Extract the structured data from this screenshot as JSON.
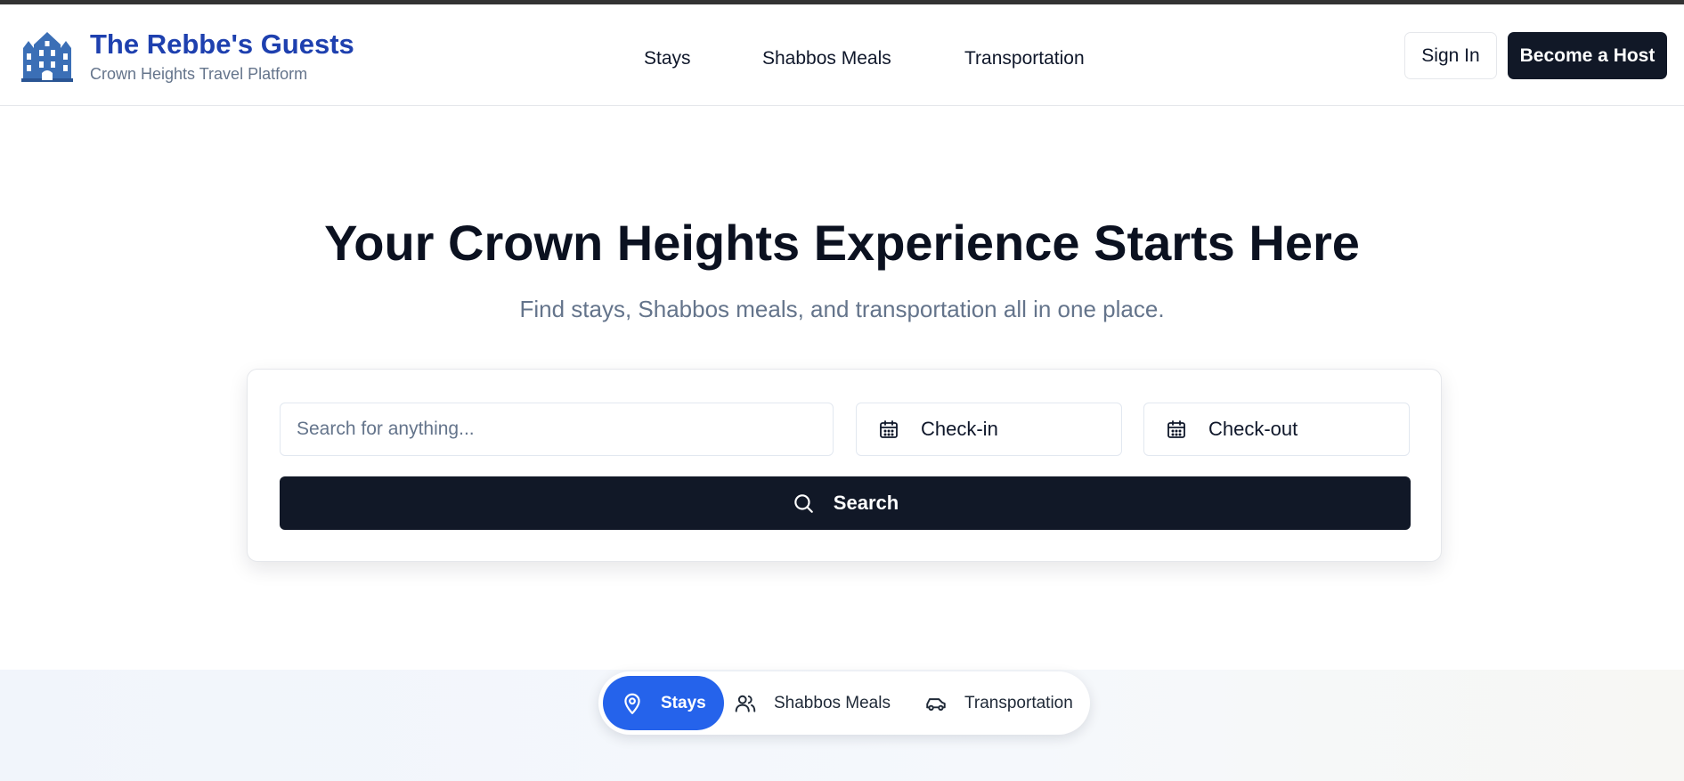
{
  "brand": {
    "title": "The Rebbe's Guests",
    "subtitle": "Crown Heights Travel Platform",
    "icon": "building-icon"
  },
  "nav": {
    "items": [
      {
        "label": "Stays"
      },
      {
        "label": "Shabbos Meals"
      },
      {
        "label": "Transportation"
      }
    ]
  },
  "auth": {
    "sign_in_label": "Sign In",
    "become_host_label": "Become a Host"
  },
  "hero": {
    "title": "Your Crown Heights Experience Starts Here",
    "subtitle": "Find stays, Shabbos meals, and transportation all in one place."
  },
  "search": {
    "placeholder": "Search for anything...",
    "value": "",
    "check_in_label": "Check-in",
    "check_out_label": "Check-out",
    "button_label": "Search",
    "icons": [
      "calendar-icon",
      "search-icon"
    ]
  },
  "categories": {
    "tabs": [
      {
        "label": "Stays",
        "icon": "map-pin-icon",
        "active": true
      },
      {
        "label": "Shabbos Meals",
        "icon": "users-icon",
        "active": false
      },
      {
        "label": "Transportation",
        "icon": "car-icon",
        "active": false
      }
    ]
  },
  "colors": {
    "brand_blue": "#1e40af",
    "primary_dark": "#111827",
    "active_tab": "#2563eb",
    "muted_text": "#64748b"
  }
}
